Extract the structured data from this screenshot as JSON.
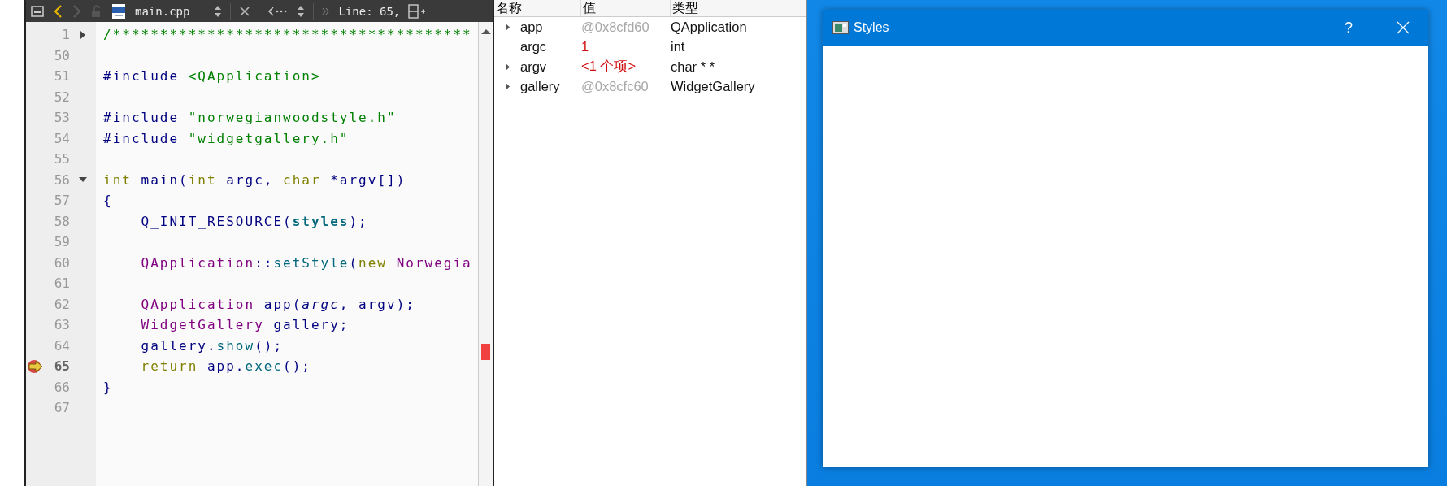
{
  "editor_toolbar": {
    "file_name": "main.cpp",
    "position": "Line: 65,",
    "back_enabled": true,
    "forward_enabled": false
  },
  "code": {
    "lines": [
      {
        "number": "1",
        "collapsed": true,
        "current": false,
        "tokens": [
          {
            "text": "/**************************************",
            "kind": "comment"
          }
        ]
      },
      {
        "number": "50",
        "current": false
      },
      {
        "number": "51",
        "current": false,
        "tokens": [
          {
            "text": "#include ",
            "kind": "preproc"
          },
          {
            "text": "<QApplication>",
            "kind": "string"
          }
        ]
      },
      {
        "number": "52",
        "current": false
      },
      {
        "number": "53",
        "current": false,
        "tokens": [
          {
            "text": "#include ",
            "kind": "preproc"
          },
          {
            "text": "\"norwegianwoodstyle.h\"",
            "kind": "string"
          }
        ]
      },
      {
        "number": "54",
        "current": false,
        "tokens": [
          {
            "text": "#include ",
            "kind": "preproc"
          },
          {
            "text": "\"widgetgallery.h\"",
            "kind": "string"
          }
        ]
      },
      {
        "number": "55",
        "current": false
      },
      {
        "number": "56",
        "collapsed": false,
        "current": false,
        "tokens": [
          {
            "text": "int",
            "kind": "keyword"
          },
          {
            "text": " main(",
            "kind": "plain"
          },
          {
            "text": "int",
            "kind": "keyword"
          },
          {
            "text": " argc, ",
            "kind": "plain"
          },
          {
            "text": "char",
            "kind": "keyword"
          },
          {
            "text": " *argv[])",
            "kind": "plain"
          }
        ]
      },
      {
        "number": "57",
        "current": false,
        "tokens": [
          {
            "text": "{",
            "kind": "plain"
          }
        ]
      },
      {
        "number": "58",
        "current": false,
        "tokens": [
          {
            "text": "    Q_INIT_RESOURCE(",
            "kind": "plain"
          },
          {
            "text": "styles",
            "kind": "macro_arg"
          },
          {
            "text": ");",
            "kind": "plain"
          }
        ]
      },
      {
        "number": "59",
        "current": false
      },
      {
        "number": "60",
        "current": false,
        "tokens": [
          {
            "text": "    QApplication",
            "kind": "type"
          },
          {
            "text": "::",
            "kind": "plain"
          },
          {
            "text": "setStyle",
            "kind": "function"
          },
          {
            "text": "(",
            "kind": "plain"
          },
          {
            "text": "new",
            "kind": "keyword"
          },
          {
            "text": " Norwegia",
            "kind": "type"
          }
        ]
      },
      {
        "number": "61",
        "current": false
      },
      {
        "number": "62",
        "current": false,
        "tokens": [
          {
            "text": "    QApplication",
            "kind": "type"
          },
          {
            "text": " app(",
            "kind": "plain"
          },
          {
            "text": "argc",
            "kind": "parameter"
          },
          {
            "text": ", argv);",
            "kind": "plain"
          }
        ]
      },
      {
        "number": "63",
        "current": false,
        "tokens": [
          {
            "text": "    WidgetGallery",
            "kind": "type"
          },
          {
            "text": " gallery;",
            "kind": "plain"
          }
        ]
      },
      {
        "number": "64",
        "current": false,
        "tokens": [
          {
            "text": "    gallery.",
            "kind": "plain"
          },
          {
            "text": "show",
            "kind": "function"
          },
          {
            "text": "();",
            "kind": "plain"
          }
        ]
      },
      {
        "number": "65",
        "current": true,
        "tokens": [
          {
            "text": "    return",
            "kind": "keyword"
          },
          {
            "text": " app.",
            "kind": "plain"
          },
          {
            "text": "exec",
            "kind": "function"
          },
          {
            "text": "();",
            "kind": "plain"
          }
        ]
      },
      {
        "number": "66",
        "current": false,
        "tokens": [
          {
            "text": "}",
            "kind": "plain"
          }
        ]
      },
      {
        "number": "67",
        "current": false
      }
    ]
  },
  "locals": {
    "columns": [
      "名称",
      "值",
      "类型"
    ],
    "rows": [
      {
        "name": "app",
        "value": "@0x8cfd60",
        "type": "QApplication",
        "expandable": true,
        "changed": false
      },
      {
        "name": "argc",
        "value": "1",
        "type": "int",
        "expandable": false,
        "changed": true
      },
      {
        "name": "argv",
        "value": "<1 个项>",
        "type": "char * *",
        "expandable": true,
        "changed": true
      },
      {
        "name": "gallery",
        "value": "@0x8cfc60",
        "type": "WidgetGallery",
        "expandable": true,
        "changed": false
      }
    ]
  },
  "styles_window": {
    "title": "Styles",
    "help": "?"
  }
}
